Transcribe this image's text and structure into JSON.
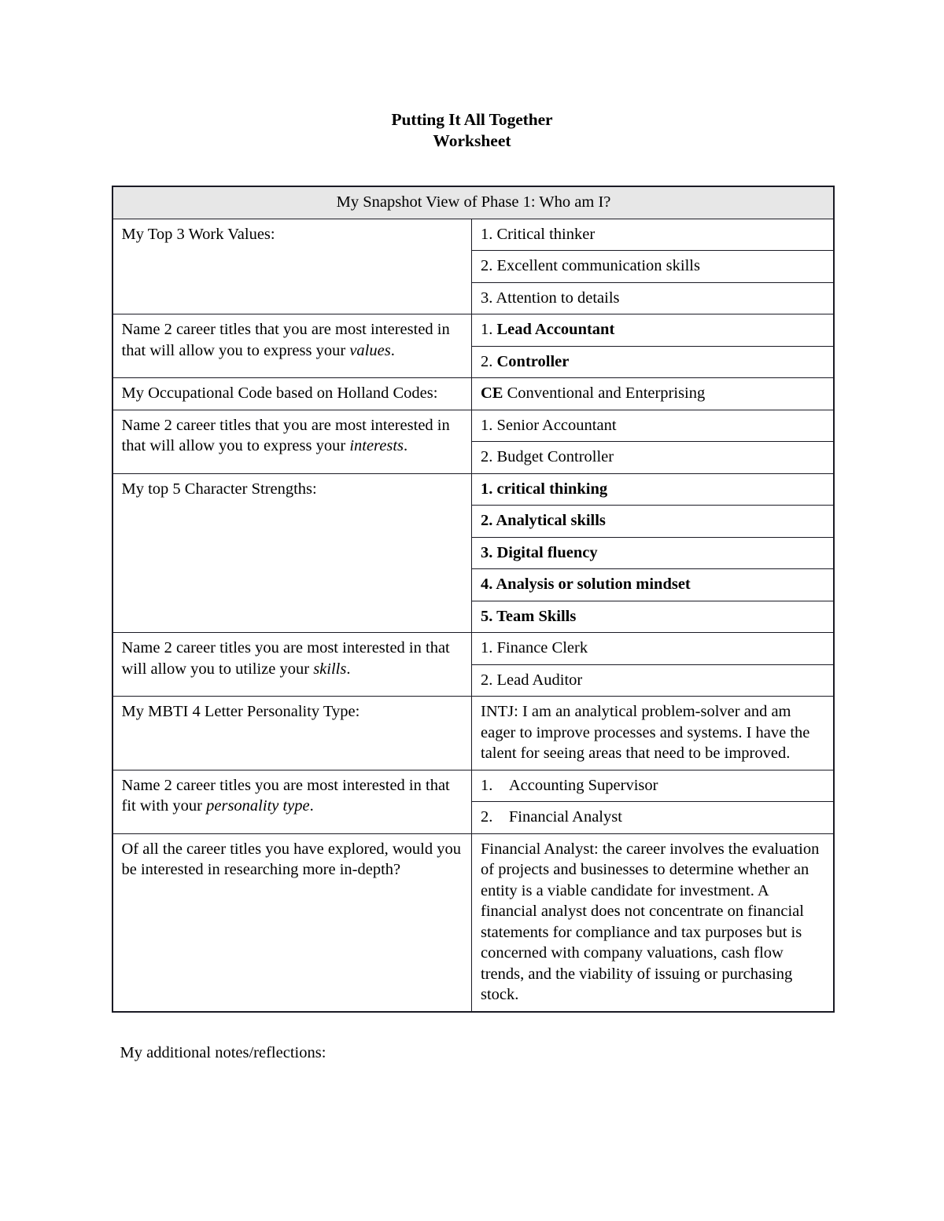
{
  "document": {
    "title": "Putting It All Together",
    "subtitle": "Worksheet",
    "notes_label": "My additional notes/reflections:"
  },
  "table": {
    "header": "My Snapshot View of Phase 1: Who am I?",
    "rows": [
      {
        "label_parts": [
          {
            "text": "My Top 3 Work Values:",
            "style": "normal"
          }
        ],
        "values": [
          {
            "parts": [
              {
                "text": "1. Critical thinker",
                "style": "normal"
              }
            ]
          },
          {
            "parts": [
              {
                "text": "2. Excellent communication skills",
                "style": "normal"
              }
            ]
          },
          {
            "parts": [
              {
                "text": "3. Attention to details",
                "style": "normal"
              }
            ]
          }
        ]
      },
      {
        "label_parts": [
          {
            "text": "Name 2 career titles that you are most interested in that will allow you to express your ",
            "style": "normal"
          },
          {
            "text": "values",
            "style": "italic"
          },
          {
            "text": ".",
            "style": "normal"
          }
        ],
        "values": [
          {
            "parts": [
              {
                "text": "1. ",
                "style": "normal"
              },
              {
                "text": "Lead Accountant",
                "style": "bold"
              }
            ]
          },
          {
            "parts": [
              {
                "text": "2. ",
                "style": "normal"
              },
              {
                "text": "Controller",
                "style": "bold"
              }
            ]
          }
        ]
      },
      {
        "label_parts": [
          {
            "text": "My Occupational Code based on Holland Codes:",
            "style": "normal"
          }
        ],
        "values": [
          {
            "parts": [
              {
                "text": "CE",
                "style": "bold"
              },
              {
                "text": " Conventional and Enterprising",
                "style": "normal"
              }
            ]
          }
        ]
      },
      {
        "label_parts": [
          {
            "text": "Name 2 career titles that you are most interested in that will allow you to express your ",
            "style": "normal"
          },
          {
            "text": "interests",
            "style": "italic"
          },
          {
            "text": ".",
            "style": "normal"
          }
        ],
        "values": [
          {
            "parts": [
              {
                "text": "1. Senior Accountant",
                "style": "normal"
              }
            ]
          },
          {
            "parts": [
              {
                "text": "2. Budget Controller",
                "style": "normal"
              }
            ]
          }
        ]
      },
      {
        "label_parts": [
          {
            "text": "My top 5 Character Strengths:",
            "style": "normal"
          }
        ],
        "values": [
          {
            "parts": [
              {
                "text": "1. critical thinking",
                "style": "bold"
              }
            ]
          },
          {
            "parts": [
              {
                "text": "2. Analytical skills",
                "style": "bold"
              }
            ]
          },
          {
            "parts": [
              {
                "text": "3. Digital fluency",
                "style": "bold"
              }
            ]
          },
          {
            "parts": [
              {
                "text": "4. Analysis or solution mindset",
                "style": "bold"
              }
            ]
          },
          {
            "parts": [
              {
                "text": "5. Team Skills",
                "style": "bold"
              }
            ]
          }
        ]
      },
      {
        "label_parts": [
          {
            "text": "Name 2 career titles you are most interested in that will allow you to utilize your ",
            "style": "normal"
          },
          {
            "text": "skills",
            "style": "italic"
          },
          {
            "text": ".",
            "style": "normal"
          }
        ],
        "values": [
          {
            "parts": [
              {
                "text": "1. Finance Clerk",
                "style": "normal"
              }
            ]
          },
          {
            "parts": [
              {
                "text": "2. Lead Auditor",
                "style": "normal"
              }
            ]
          }
        ]
      },
      {
        "label_parts": [
          {
            "text": "My MBTI 4 Letter Personality Type:",
            "style": "normal"
          }
        ],
        "values": [
          {
            "parts": [
              {
                "text": "INTJ: I am an analytical problem-solver and am eager to improve processes and systems. I have the talent for seeing areas that need to be improved.",
                "style": "normal"
              }
            ]
          }
        ]
      },
      {
        "label_parts": [
          {
            "text": "Name 2 career titles you are most interested in that fit with your ",
            "style": "normal"
          },
          {
            "text": "personality type",
            "style": "italic"
          },
          {
            "text": ".",
            "style": "normal"
          }
        ],
        "indent": true,
        "values": [
          {
            "parts": [
              {
                "text": "1. Accounting Supervisor",
                "style": "normal"
              }
            ]
          },
          {
            "parts": [
              {
                "text": "2. Financial Analyst",
                "style": "normal"
              }
            ]
          }
        ]
      },
      {
        "label_parts": [
          {
            "text": "Of all the career titles you have explored, would you be interested in researching more in-depth?",
            "style": "normal"
          }
        ],
        "values": [
          {
            "parts": [
              {
                "text": "Financial Analyst: the career involves the evaluation of projects and businesses to determine whether an entity is a viable candidate for investment. A financial analyst does not concentrate on financial statements for compliance and tax purposes but is concerned with company valuations, cash flow trends, and the viability of issuing or purchasing stock.",
                "style": "normal"
              }
            ]
          }
        ]
      }
    ]
  },
  "colors": {
    "header_background": "#e7e7e7",
    "border": "#1a1a24",
    "text": "#000000",
    "page_background": "#ffffff"
  }
}
